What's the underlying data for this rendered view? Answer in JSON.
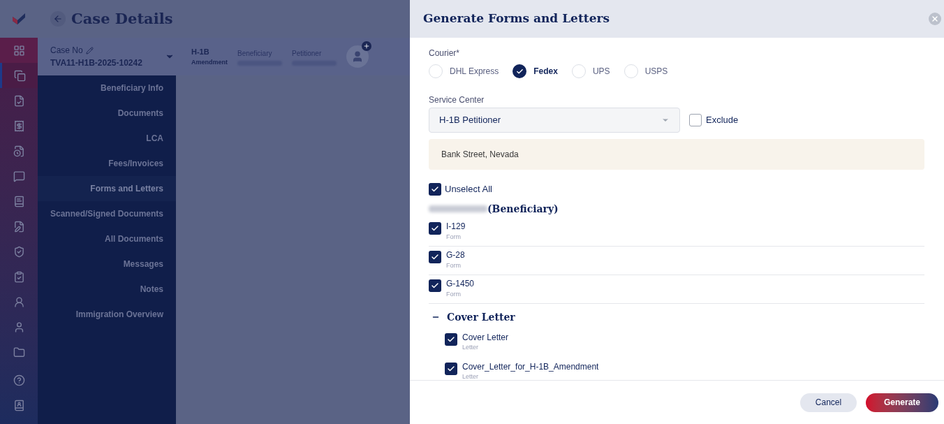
{
  "rail": {
    "items": [
      {
        "kind": "dashboard",
        "selected": false
      },
      {
        "kind": "copy",
        "selected": true
      },
      {
        "kind": "file-check",
        "selected": false
      },
      {
        "kind": "invoice",
        "selected": false
      },
      {
        "kind": "file-clock",
        "selected": false
      },
      {
        "kind": "message",
        "selected": false
      },
      {
        "kind": "book",
        "selected": false
      },
      {
        "kind": "edit",
        "selected": false
      },
      {
        "kind": "shield",
        "selected": false
      },
      {
        "kind": "clipboard",
        "selected": false
      },
      {
        "kind": "user-tie",
        "selected": false
      },
      {
        "kind": "user",
        "selected": false
      },
      {
        "kind": "folder",
        "selected": false
      },
      {
        "kind": "help",
        "selected": false
      },
      {
        "kind": "contact",
        "selected": false
      }
    ]
  },
  "page": {
    "title": "Case Details"
  },
  "case_bar": {
    "case_label": "Case No",
    "case_number": "TVA11-H1B-2025-10242",
    "visa_type": "H-1B",
    "visa_subtype": "Amendment",
    "beneficiary_label": "Beneficiary",
    "petitioner_label": "Petitioner"
  },
  "case_nav": {
    "items": [
      {
        "label": "Beneficiary Info",
        "selected": false
      },
      {
        "label": "Documents",
        "selected": false
      },
      {
        "label": "LCA",
        "selected": false
      },
      {
        "label": "Fees/Invoices",
        "selected": false
      },
      {
        "label": "Forms and Letters",
        "selected": true
      },
      {
        "label": "Scanned/Signed Documents",
        "selected": false
      },
      {
        "label": "All Documents",
        "selected": false
      },
      {
        "label": "Messages",
        "selected": false
      },
      {
        "label": "Notes",
        "selected": false
      },
      {
        "label": "Immigration Overview",
        "selected": false
      }
    ]
  },
  "drawer": {
    "title": "Generate Forms and Letters",
    "courier": {
      "label": "Courier*",
      "options": [
        {
          "label": "DHL Express",
          "selected": false
        },
        {
          "label": "Fedex",
          "selected": true
        },
        {
          "label": "UPS",
          "selected": false
        },
        {
          "label": "USPS",
          "selected": false
        }
      ]
    },
    "service_center": {
      "label": "Service Center",
      "value": "H-1B Petitioner",
      "exclude": {
        "label": "Exclude",
        "checked": false
      },
      "address": "Bank Street, Nevada"
    },
    "select_all": {
      "label": "Unselect All",
      "checked": true
    },
    "group": {
      "title": "(Beneficiary)",
      "items": [
        {
          "name": "I-129",
          "type": "Form",
          "checked": true
        },
        {
          "name": "G-28",
          "type": "Form",
          "checked": true
        },
        {
          "name": "G-1450",
          "type": "Form",
          "checked": true
        }
      ]
    },
    "section": {
      "title": "Cover Letter",
      "expanded": true,
      "items": [
        {
          "name": "Cover Letter",
          "type": "Letter",
          "checked": true
        },
        {
          "name": "Cover_Letter_for_H-1B_Amendment",
          "type": "Letter",
          "checked": true
        }
      ]
    },
    "buttons": {
      "cancel": "Cancel",
      "generate": "Generate"
    }
  }
}
